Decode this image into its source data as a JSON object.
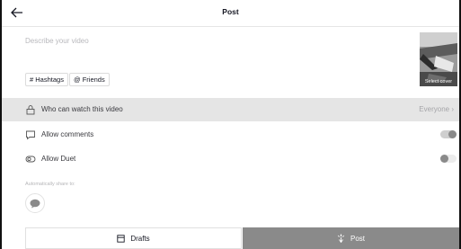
{
  "header": {
    "title": "Post",
    "back_icon": "arrow-left-icon"
  },
  "caption": {
    "placeholder": "Describe your video",
    "value": ""
  },
  "chips": {
    "hashtags": "# Hashtags",
    "friends": "@ Friends"
  },
  "cover": {
    "label": "Select cover"
  },
  "settings": {
    "who_can_watch": {
      "label": "Who can watch this video",
      "value": "Everyone",
      "chevron": "›",
      "icon": "lock-icon"
    },
    "allow_comments": {
      "label": "Allow comments",
      "enabled": true,
      "icon": "comment-icon"
    },
    "allow_duet": {
      "label": "Allow Duet",
      "enabled": false,
      "icon": "duet-icon"
    }
  },
  "auto_share": {
    "label": "Automatically share to:",
    "targets": [
      "message-bubble-icon"
    ]
  },
  "footer": {
    "drafts_label": "Drafts",
    "post_label": "Post"
  },
  "colors": {
    "post_button": "#8a8a8a",
    "row_highlight": "#e5e5e5"
  }
}
